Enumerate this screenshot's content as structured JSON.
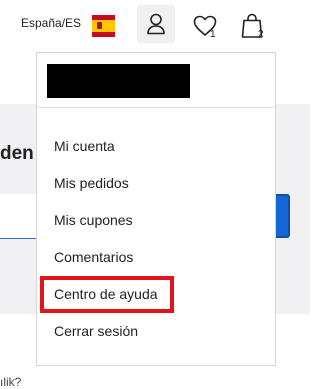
{
  "header": {
    "locale": "España/ES",
    "wishlist_count": "1",
    "cart_count": "2"
  },
  "icons": {
    "flag": "spain-flag-icon",
    "account": "user-icon",
    "wishlist": "heart-icon",
    "cart": "shopping-bag-icon"
  },
  "page": {
    "heading_fragment": "den",
    "bottom_fragment": "ılik?"
  },
  "dropdown": {
    "user_name": "",
    "items": [
      {
        "label": "Mi cuenta"
      },
      {
        "label": "Mis pedidos"
      },
      {
        "label": "Mis cupones"
      },
      {
        "label": "Comentarios"
      },
      {
        "label": "Centro de ayuda"
      },
      {
        "label": "Cerrar sesión"
      }
    ],
    "highlighted_index": 4
  },
  "colors": {
    "highlight": "#e1141a",
    "accent_blue": "#1467d4",
    "page_bg": "#f1f1f3"
  }
}
